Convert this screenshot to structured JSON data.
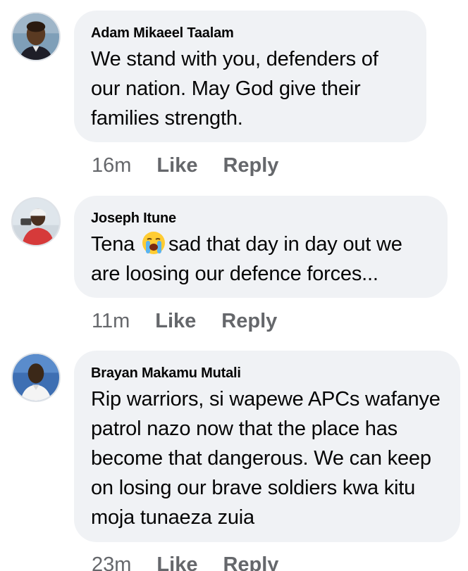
{
  "comments": [
    {
      "author": "Adam Mikaeel Taalam",
      "text": "We stand with you, defenders of our nation. May God give their families strength.",
      "time": "16m",
      "like": "Like",
      "reply": "Reply"
    },
    {
      "author": "Joseph Itune",
      "text_before": "Tena",
      "emoji": "loudly-crying-face",
      "text_after": "sad that day in day out we are loosing our defence forces...",
      "time": "11m",
      "like": "Like",
      "reply": "Reply"
    },
    {
      "author": "Brayan Makamu Mutali",
      "text": "Rip warriors, si wapewe APCs wafanye patrol nazo now that the place has become that dangerous. We can keep on losing our brave soldiers kwa kitu moja tunaeza zuia",
      "time": "23m",
      "like": "Like",
      "reply": "Reply"
    }
  ],
  "colors": {
    "bubble": "#f0f2f5",
    "text": "#050505",
    "meta": "#65676b"
  }
}
